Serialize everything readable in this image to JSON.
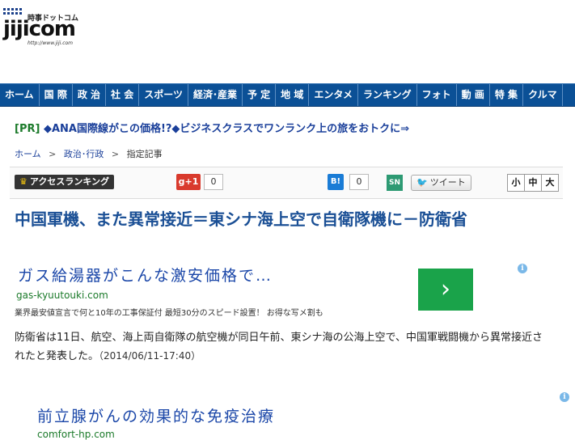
{
  "logo": {
    "kana": "時事ドットコム",
    "word": "jijicom",
    "url": "http://www.jiji.com"
  },
  "nav": [
    "ホーム",
    "国 際",
    "政 治",
    "社 会",
    "スポーツ",
    "経済･産業",
    "予 定",
    "地 域",
    "エンタメ",
    "ランキング",
    "フォト",
    "動 画",
    "特 集",
    "クルマ"
  ],
  "pr": {
    "tag": "[PR]",
    "text": "◆ANA国際線がこの価格!?◆ビジネスクラスでワンランク上の旅をおトクに⇒"
  },
  "breadcrumb": {
    "home": "ホーム",
    "sep": ">",
    "category": "政治･行政",
    "current": "指定記事"
  },
  "toolbar": {
    "ranking": "アクセスランキング",
    "gplus": "g+1",
    "gplus_count": "0",
    "hatena": "B!",
    "hatena_count": "0",
    "sn": "SN",
    "tweet": "ツイート",
    "sizes": [
      "小",
      "中",
      "大"
    ]
  },
  "article": {
    "headline": "中国軍機、また異常接近＝東シナ海上空で自衛隊機に－防衛省",
    "body": "防衛省は11日、航空、海上両自衛隊の航空機が同日午前、東シナ海の公海上空で、中国軍戦闘機から異常接近されたと発表した。",
    "timestamp": "（2014/06/11-17:40）"
  },
  "ad1": {
    "title": "ガス給湯器がこんな激安価格で…",
    "url": "gas-kyuutouki.com",
    "desc": "業界最安値宣言で何と10年の工事保証付 最短30分のスピード設置！ お得な写メ割も",
    "info": "i",
    "go": "›"
  },
  "ad2": {
    "title": "前立腺がんの効果的な免疫治療",
    "url": "comfort-hp.com",
    "info": "i"
  }
}
